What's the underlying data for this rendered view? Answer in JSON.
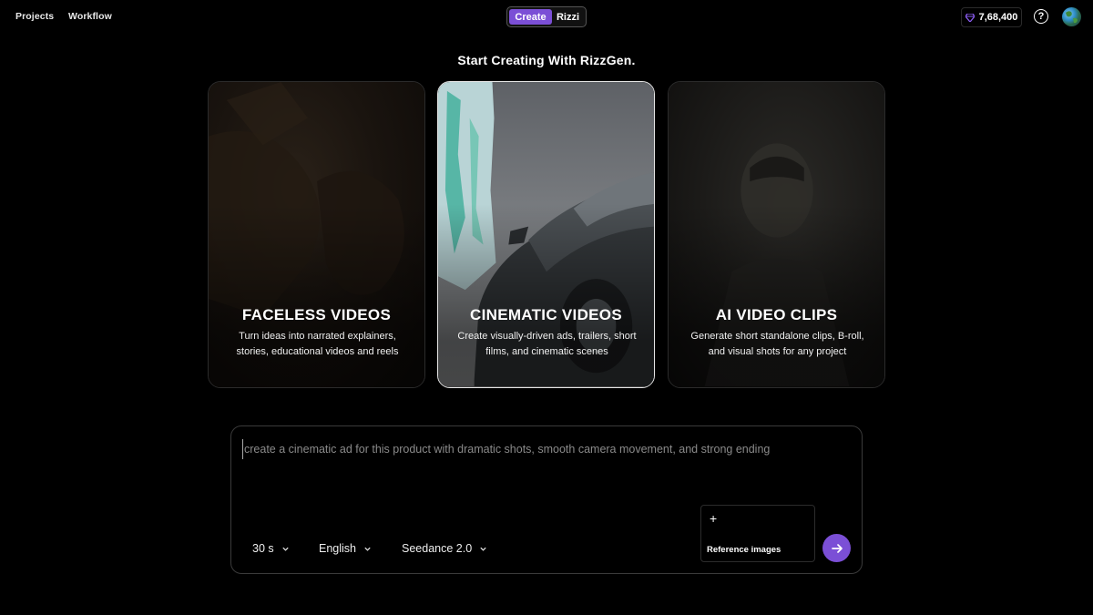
{
  "nav": {
    "projects": "Projects",
    "workflow": "Workflow"
  },
  "mode_toggle": {
    "create": "Create",
    "rizzi": "Rizzi",
    "active": "Create"
  },
  "credits": {
    "value": "7,68,400",
    "icon": "gem-icon"
  },
  "help": {
    "icon": "help-circle-icon",
    "glyph": "?"
  },
  "headline": "Start Creating With RizzGen.",
  "cards": [
    {
      "title": "FACELESS VIDEOS",
      "description": "Turn ideas into narrated explainers, stories, educational videos and reels"
    },
    {
      "title": "CINEMATIC VIDEOS",
      "description": "Create visually-driven ads, trailers, short films, and cinematic scenes"
    },
    {
      "title": "AI VIDEO CLIPS",
      "description": "Generate short standalone clips, B-roll, and visual shots for any project"
    }
  ],
  "selected_card": "CINEMATIC VIDEOS",
  "prompt": {
    "placeholder": "create a cinematic ad for this product with dramatic shots, smooth camera movement, and strong ending",
    "value": ""
  },
  "options": {
    "duration": "30 s",
    "language": "English",
    "model": "Seedance 2.0"
  },
  "reference": {
    "plus": "+",
    "label": "Reference images"
  },
  "colors": {
    "accent": "#7b4fd6",
    "background": "#000000"
  }
}
